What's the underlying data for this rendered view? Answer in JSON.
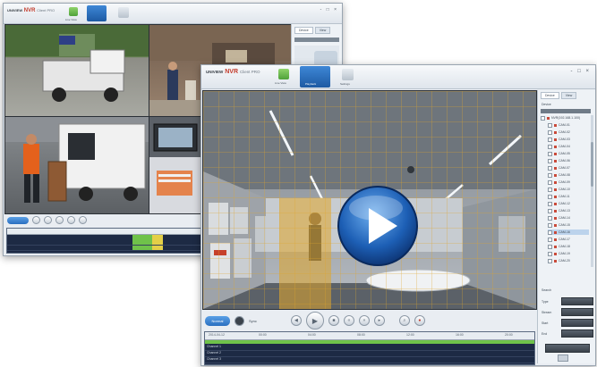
{
  "brand": {
    "prefix": "UNIVIEW",
    "product": "NVR",
    "suffix": "Client PRO"
  },
  "toolbar": {
    "live_label": "Live View",
    "playback_label": "Playback",
    "settings_label": "Settings"
  },
  "window_controls": "- □ ×",
  "sidebar": {
    "tabs": [
      "Device",
      "View"
    ],
    "panel_label": "Device",
    "devices": [
      "NVR(192.168.1.100)",
      "CAM-01",
      "CAM-02",
      "CAM-03",
      "CAM-04",
      "CAM-05",
      "CAM-06",
      "CAM-07",
      "CAM-08",
      "CAM-09",
      "CAM-10",
      "CAM-11",
      "CAM-12",
      "CAM-13",
      "CAM-14",
      "CAM-15",
      "CAM-16",
      "CAM-17",
      "CAM-18",
      "CAM-19",
      "CAM-20"
    ],
    "search_section": "Search",
    "fields": [
      {
        "label": "Type"
      },
      {
        "label": "Stream"
      },
      {
        "label": "Start"
      },
      {
        "label": "End"
      }
    ]
  },
  "playback": {
    "mode_label": "Normal",
    "sync_label": "Sync"
  },
  "timeline": {
    "date_label": "2014-04-12",
    "ticks": [
      "00:00",
      "04:00",
      "08:00",
      "12:00",
      "16:00",
      "20:00"
    ],
    "channels": [
      "Channel 1",
      "Channel 2",
      "Channel 3"
    ]
  },
  "colors": {
    "accent_blue": "#2a6fc0",
    "record_green": "#6fc24a",
    "record_yellow": "#e4cf47",
    "motion_zone": "#e0a52a"
  },
  "icons": {
    "play_overlay": "play-icon"
  }
}
